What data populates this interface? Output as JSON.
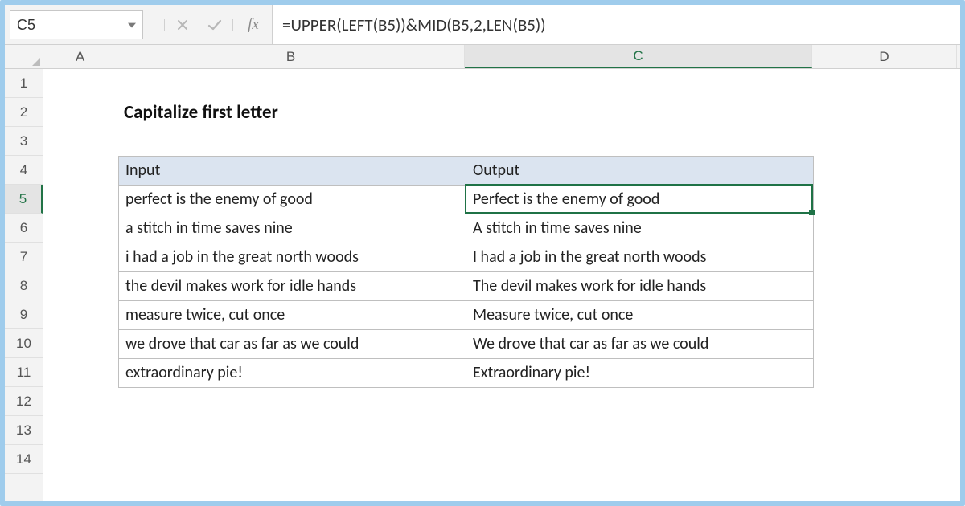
{
  "active_cell": "C5",
  "formula": "=UPPER(LEFT(B5))&MID(B5,2,LEN(B5))",
  "fx_label": "fx",
  "columns": [
    "A",
    "B",
    "C",
    "D"
  ],
  "rows": [
    "1",
    "2",
    "3",
    "4",
    "5",
    "6",
    "7",
    "8",
    "9",
    "10",
    "11",
    "12",
    "13",
    "14"
  ],
  "active_column_index": 2,
  "active_row_index": 4,
  "title_cell": {
    "row": 2,
    "col": "B",
    "text": "Capitalize first letter"
  },
  "table": {
    "start": {
      "row": 4,
      "col": "B"
    },
    "headers": {
      "input": "Input",
      "output": "Output"
    },
    "rows": [
      {
        "input": "perfect is the enemy of good",
        "output": "Perfect is the enemy of good"
      },
      {
        "input": "a stitch in time saves nine",
        "output": "A stitch in time saves nine"
      },
      {
        "input": "i had a job in the great north woods",
        "output": "I had a job in the great north woods"
      },
      {
        "input": "the devil makes work for idle hands",
        "output": "The devil makes work for idle hands"
      },
      {
        "input": "measure twice, cut once",
        "output": "Measure twice, cut once"
      },
      {
        "input": "we drove that car as far as we could",
        "output": "We drove that car as far as we could"
      },
      {
        "input": "extraordinary pie!",
        "output": "Extraordinary pie!"
      }
    ]
  }
}
